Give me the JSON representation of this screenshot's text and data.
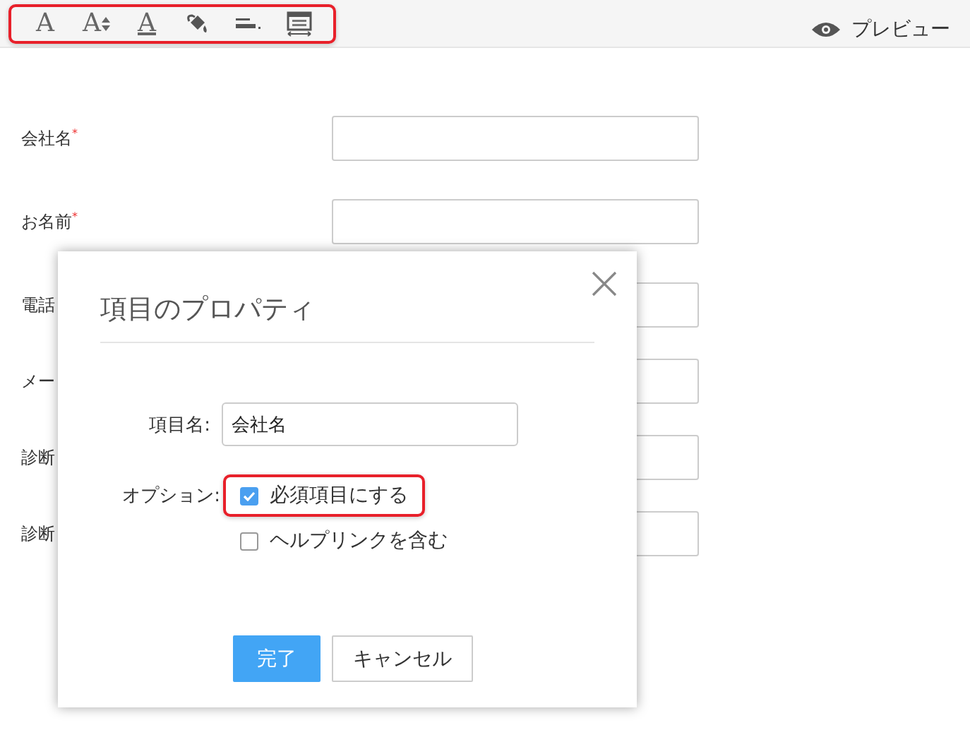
{
  "toolbar": {
    "highlighted": true,
    "tools": [
      {
        "kind": "font",
        "glyph": "A"
      },
      {
        "kind": "font-size",
        "glyph": "A"
      },
      {
        "kind": "font-color",
        "glyph": "A"
      },
      {
        "kind": "fill"
      },
      {
        "kind": "line"
      },
      {
        "kind": "layout"
      }
    ],
    "preview": {
      "label": "プレビュー"
    }
  },
  "form": {
    "fields": [
      {
        "label": "会社名",
        "required_mark": "*"
      },
      {
        "label": "お名前",
        "required_mark": "*"
      },
      {
        "label": "電話"
      },
      {
        "label": "メー"
      },
      {
        "label": "診断"
      },
      {
        "label": "診断"
      }
    ]
  },
  "dialog": {
    "title": "項目のプロパティ",
    "name_label": "項目名:",
    "name_value": "会社名",
    "options_label": "オプション:",
    "options": [
      {
        "label": "必須項目にする",
        "checked": true,
        "highlighted": true
      },
      {
        "label": "ヘルプリンクを含む",
        "checked": false,
        "highlighted": false
      }
    ],
    "buttons": [
      {
        "label": "完了",
        "kind": "primary"
      },
      {
        "label": "キャンセル",
        "kind": "secondary"
      }
    ]
  }
}
